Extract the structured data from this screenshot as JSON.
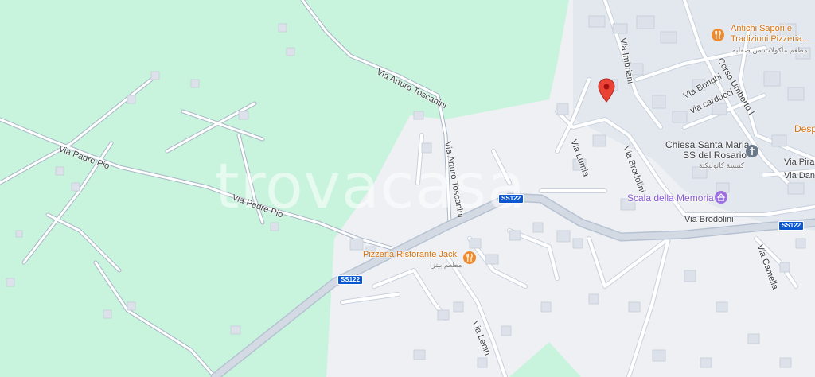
{
  "watermark": "trovacasa",
  "streets": {
    "via_arturo_toscanini_1": "Via Arturo Toscanini",
    "via_arturo_toscanini_2": "Via Arturo Toscanini",
    "via_padre_pio_1": "Via Padre Pio",
    "via_padre_pio_2": "Via Padre Pio",
    "via_lumia": "Via Lumia",
    "via_imbriani": "Via Imbriani",
    "via_bonghi": "Via Bonghi",
    "via_carducci": "via carducci",
    "corso_umberto": "Corso Umberto I",
    "via_brodolini_1": "Via Brodolini",
    "via_brodolini_2": "Via Brodolini",
    "via_pirane": "Via Pirane",
    "via_dante": "Via Dante",
    "via_camella": "Via Camella",
    "via_lenin": "Via Lenin"
  },
  "roads": {
    "ss122_a": "SS122",
    "ss122_b": "SS122",
    "ss122_c": "SS122"
  },
  "pois": {
    "antichi_sapori": {
      "name_line1": "Antichi Sapori e",
      "name_line2": "Tradizioni Pizzeria...",
      "subtitle": "مطعم مأكولات من صقلية",
      "icon": "restaurant-icon"
    },
    "pizzeria_jack": {
      "name": "Pizzeria Ristorante Jack",
      "subtitle": "مطعم بيتزا",
      "icon": "restaurant-icon"
    },
    "chiesa": {
      "name_line1": "Chiesa Santa Maria",
      "name_line2": "SS del Rosario",
      "subtitle": "كنيسة كاثوليكية",
      "icon": "church-icon"
    },
    "scala_memoria": {
      "name": "Scala della Memoria",
      "icon": "monument-icon"
    },
    "desp": {
      "name": "Desp"
    }
  },
  "colors": {
    "park": "#c8f3dc",
    "urban": "#eef0f3",
    "road": "#ffffff",
    "road_casing": "#c3cad6",
    "major_road": "#d4dae4",
    "pin": "#ea4335",
    "poi_orange": "#ee8b2f",
    "poi_purple": "#9e6fe0",
    "poi_gray": "#6b7a8a"
  }
}
